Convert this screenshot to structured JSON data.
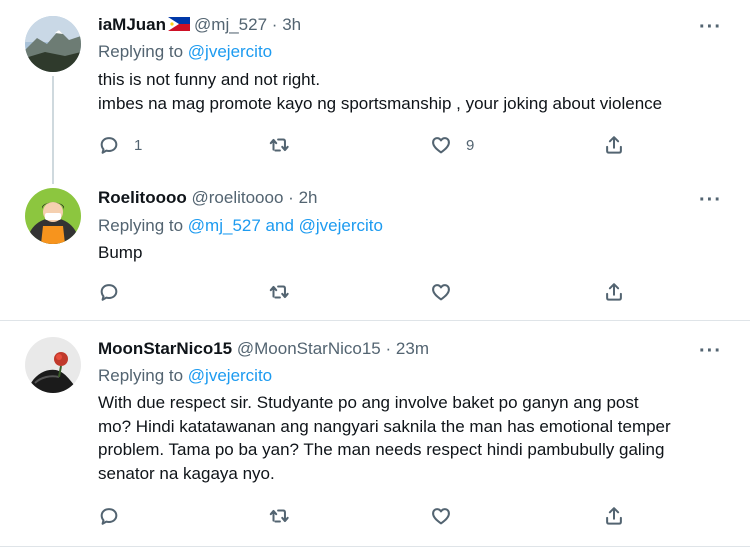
{
  "tweets": [
    {
      "name": "iaMJuan",
      "handle": "@mj_527",
      "time": "3h",
      "replying_label": "Replying to",
      "mention": "@jvejercito",
      "text_lines": [
        "this is not funny and not right.",
        "imbes na mag promote kayo ng sportsmanship , your joking about violence"
      ],
      "reply_count": "1",
      "retweet_count": "",
      "like_count": "9"
    },
    {
      "name": "Roelitoooo",
      "handle": "@roelitoooo",
      "time": "2h",
      "replying_label": "Replying to",
      "mention": "@mj_527 and @jvejercito",
      "text_lines": [
        "Bump"
      ],
      "reply_count": "",
      "retweet_count": "",
      "like_count": ""
    },
    {
      "name": "MoonStarNico15",
      "handle": "@MoonStarNico15",
      "time": "23m",
      "replying_label": "Replying to",
      "mention": "@jvejercito",
      "text_lines": [
        "With due respect sir. Studyante po ang involve baket po ganyn ang post",
        "mo? Hindi katatawanan ang nangyari saknila the man has emotional temper",
        "problem. Tama po ba yan? The man needs respect hindi pambubully galing",
        "senator na kagaya nyo."
      ],
      "reply_count": "",
      "retweet_count": "",
      "like_count": ""
    }
  ],
  "common": {
    "dot": "·",
    "more": "···"
  },
  "colors": {
    "link": "#1d9bf0",
    "muted": "#536471",
    "text": "#0f1419"
  }
}
